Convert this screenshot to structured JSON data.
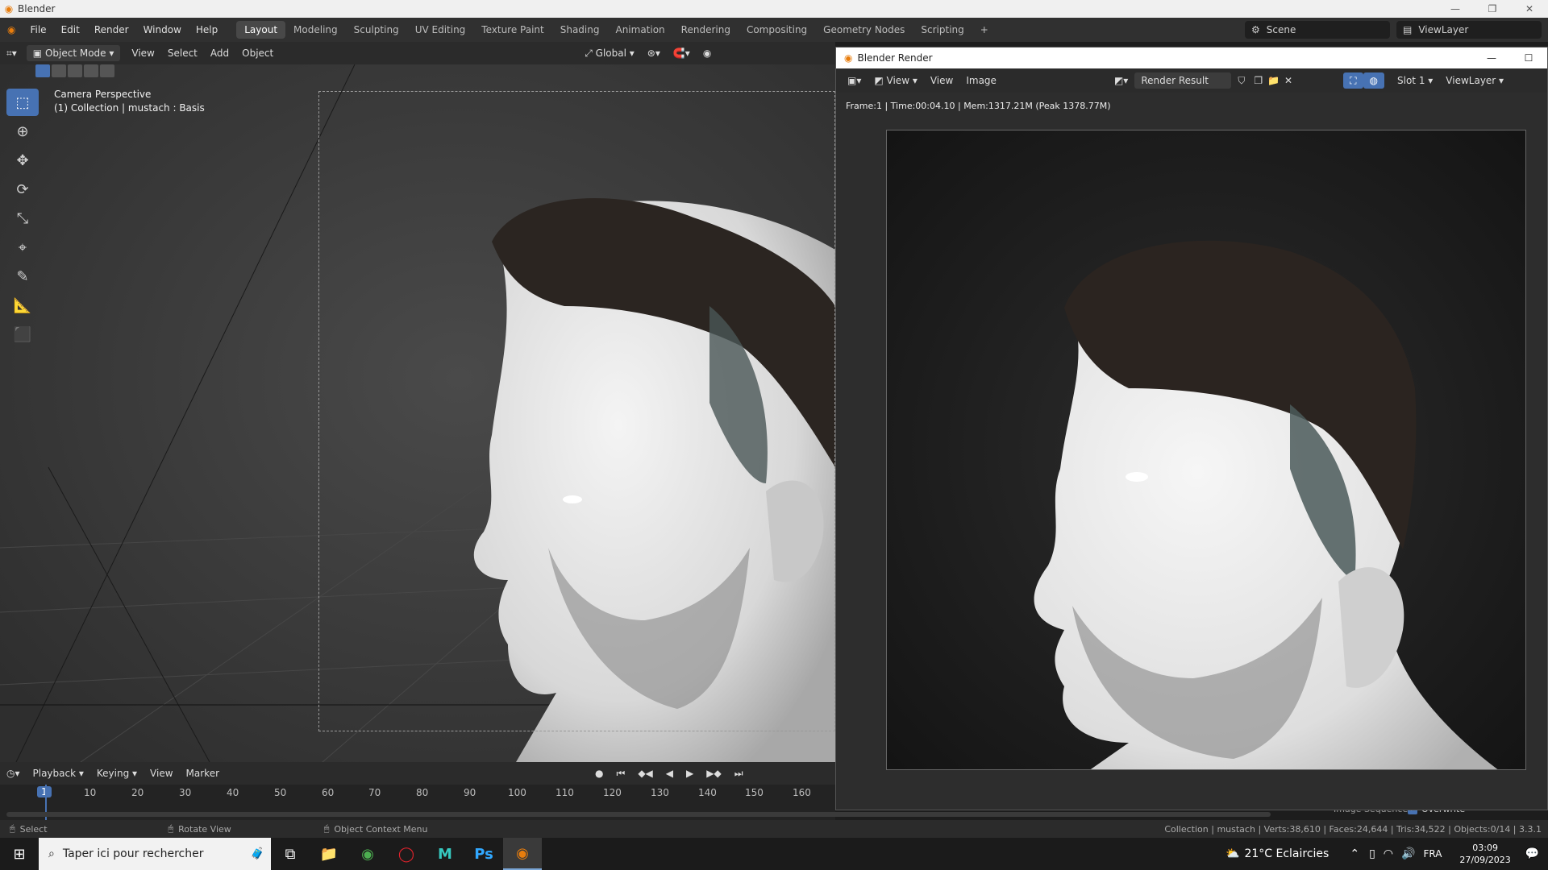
{
  "window": {
    "title": "Blender"
  },
  "menu": [
    "File",
    "Edit",
    "Render",
    "Window",
    "Help"
  ],
  "workspaces": [
    {
      "label": "Layout",
      "active": true
    },
    {
      "label": "Modeling"
    },
    {
      "label": "Sculpting"
    },
    {
      "label": "UV Editing"
    },
    {
      "label": "Texture Paint"
    },
    {
      "label": "Shading"
    },
    {
      "label": "Animation"
    },
    {
      "label": "Rendering"
    },
    {
      "label": "Compositing"
    },
    {
      "label": "Geometry Nodes"
    },
    {
      "label": "Scripting"
    }
  ],
  "scene": {
    "label": "Scene"
  },
  "viewlayer": {
    "label": "ViewLayer"
  },
  "viewport_header": {
    "mode": "Object Mode",
    "menus": [
      "View",
      "Select",
      "Add",
      "Object"
    ],
    "transform": "Global"
  },
  "viewport": {
    "overlay_line1": "Camera Perspective",
    "overlay_line2": "(1) Collection | mustach : Basis"
  },
  "timeline": {
    "menus": [
      "Playback",
      "Keying",
      "View",
      "Marker"
    ],
    "current_frame": "1",
    "frames": [
      "10",
      "20",
      "30",
      "40",
      "50",
      "60",
      "70",
      "80",
      "90",
      "100",
      "110",
      "120",
      "130",
      "140",
      "150",
      "160"
    ]
  },
  "statusbar": {
    "select": "Select",
    "rotate": "Rotate View",
    "context": "Object Context Menu",
    "stats": "Collection | mustach | Verts:38,610 | Faces:24,644 | Tris:34,522 | Objects:0/14 | 3.3.1",
    "image_sequence": "Image Sequence",
    "overwrite": "Overwrite"
  },
  "render_window": {
    "title": "Blender Render",
    "menus": [
      "View",
      "View",
      "Image"
    ],
    "result": "Render Result",
    "slot": "Slot 1",
    "viewlayer": "ViewLayer",
    "info": "Frame:1 | Time:00:04.10 | Mem:1317.21M (Peak 1378.77M)"
  },
  "taskbar": {
    "search_placeholder": "Taper ici pour rechercher",
    "weather": "21°C  Eclaircies",
    "lang": "FRA",
    "time": "03:09",
    "date": "27/09/2023"
  }
}
